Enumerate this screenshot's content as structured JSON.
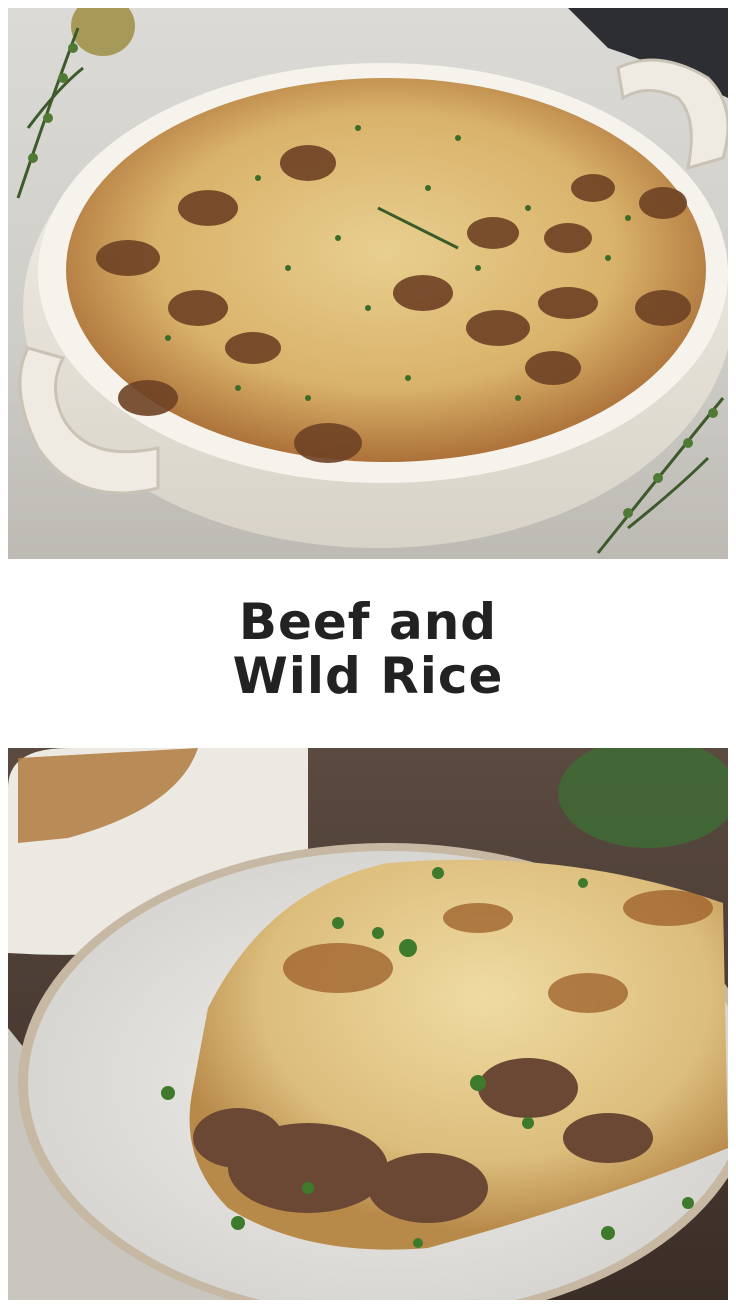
{
  "title": {
    "line1": "Beef and",
    "line2": "Wild Rice"
  },
  "images": {
    "top": "casserole-dish-photo",
    "bottom": "plated-serving-photo"
  },
  "colors": {
    "title_text": "#222222",
    "background": "#ffffff"
  }
}
